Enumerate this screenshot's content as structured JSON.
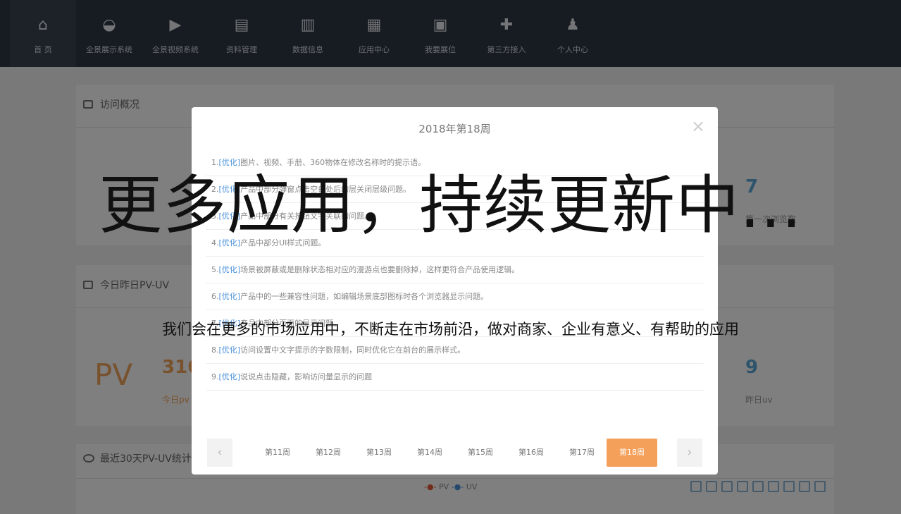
{
  "nav": {
    "items": [
      {
        "label": "首 页",
        "icon": "home-icon",
        "glyph": "⌂"
      },
      {
        "label": "全景展示系统",
        "icon": "panorama-icon",
        "glyph": "◒"
      },
      {
        "label": "全景视频系统",
        "icon": "video-camera-icon",
        "glyph": "▶"
      },
      {
        "label": "资料管理",
        "icon": "document-icon",
        "glyph": "▤"
      },
      {
        "label": "数据信息",
        "icon": "bar-chart-icon",
        "glyph": "▥"
      },
      {
        "label": "应用中心",
        "icon": "apps-icon",
        "glyph": "▦"
      },
      {
        "label": "我要展位",
        "icon": "booth-icon",
        "glyph": "▣"
      },
      {
        "label": "第三方接入",
        "icon": "puzzle-icon",
        "glyph": "✚"
      },
      {
        "label": "个人中心",
        "icon": "user-icon",
        "glyph": "♟"
      }
    ]
  },
  "page": {
    "visit_title": "访问概况",
    "stat_num": "7",
    "stat_label": "第一次浏览数",
    "pvuv_title": "今日昨日PV-UV",
    "pv_big": "PV",
    "pv_num": "316",
    "pv_label": "今日pv",
    "uv_num": "9",
    "uv_label": "昨日uv",
    "stats30_title": "最近30天PV-UV统计",
    "legend_pv": "PV",
    "legend_uv": "UV"
  },
  "modal": {
    "title": "2018年第18周",
    "close": "×",
    "items": [
      {
        "num": "1.",
        "tag": "[优化]",
        "text": "图片、视频、手册、360物体在修改名称时的提示语。"
      },
      {
        "num": "2.",
        "tag": "[优化]",
        "text": "产品中部分弹窗点击空白处后的层关闭层级问题。"
      },
      {
        "num": "3.",
        "tag": "[优化]",
        "text": "产品中部分有关按钮文字关联的问题。"
      },
      {
        "num": "4.",
        "tag": "[优化]",
        "text": "产品中部分UI样式问题。"
      },
      {
        "num": "5.",
        "tag": "[优化]",
        "text": "场景被屏蔽或是删除状态相对应的漫游点也要删除掉，这样更符合产品使用逻辑。"
      },
      {
        "num": "6.",
        "tag": "[优化]",
        "text": "产品中的一些兼容性问题，如编辑场景底部图标时各个浏览器显示问题。"
      },
      {
        "num": "7.",
        "tag": "[优化]",
        "text": "产品中部分页面的显示问题。"
      },
      {
        "num": "8.",
        "tag": "[优化]",
        "text": "访问设置中文字提示的字数限制，同时优化它在前台的展示样式。"
      },
      {
        "num": "9.",
        "tag": "[优化]",
        "text": "说说点击隐藏，影响访问量显示的问题"
      }
    ],
    "weeks": [
      "第11周",
      "第12周",
      "第13周",
      "第14周",
      "第15周",
      "第16周",
      "第17周",
      "第18周"
    ],
    "prev": "‹",
    "next": "›"
  },
  "overlay": {
    "headline": "更多应用，持续更新中...",
    "subline": "我们会在更多的市场应用中，不断走在市场前沿，做对商家、企业有意义、有帮助的应用"
  }
}
